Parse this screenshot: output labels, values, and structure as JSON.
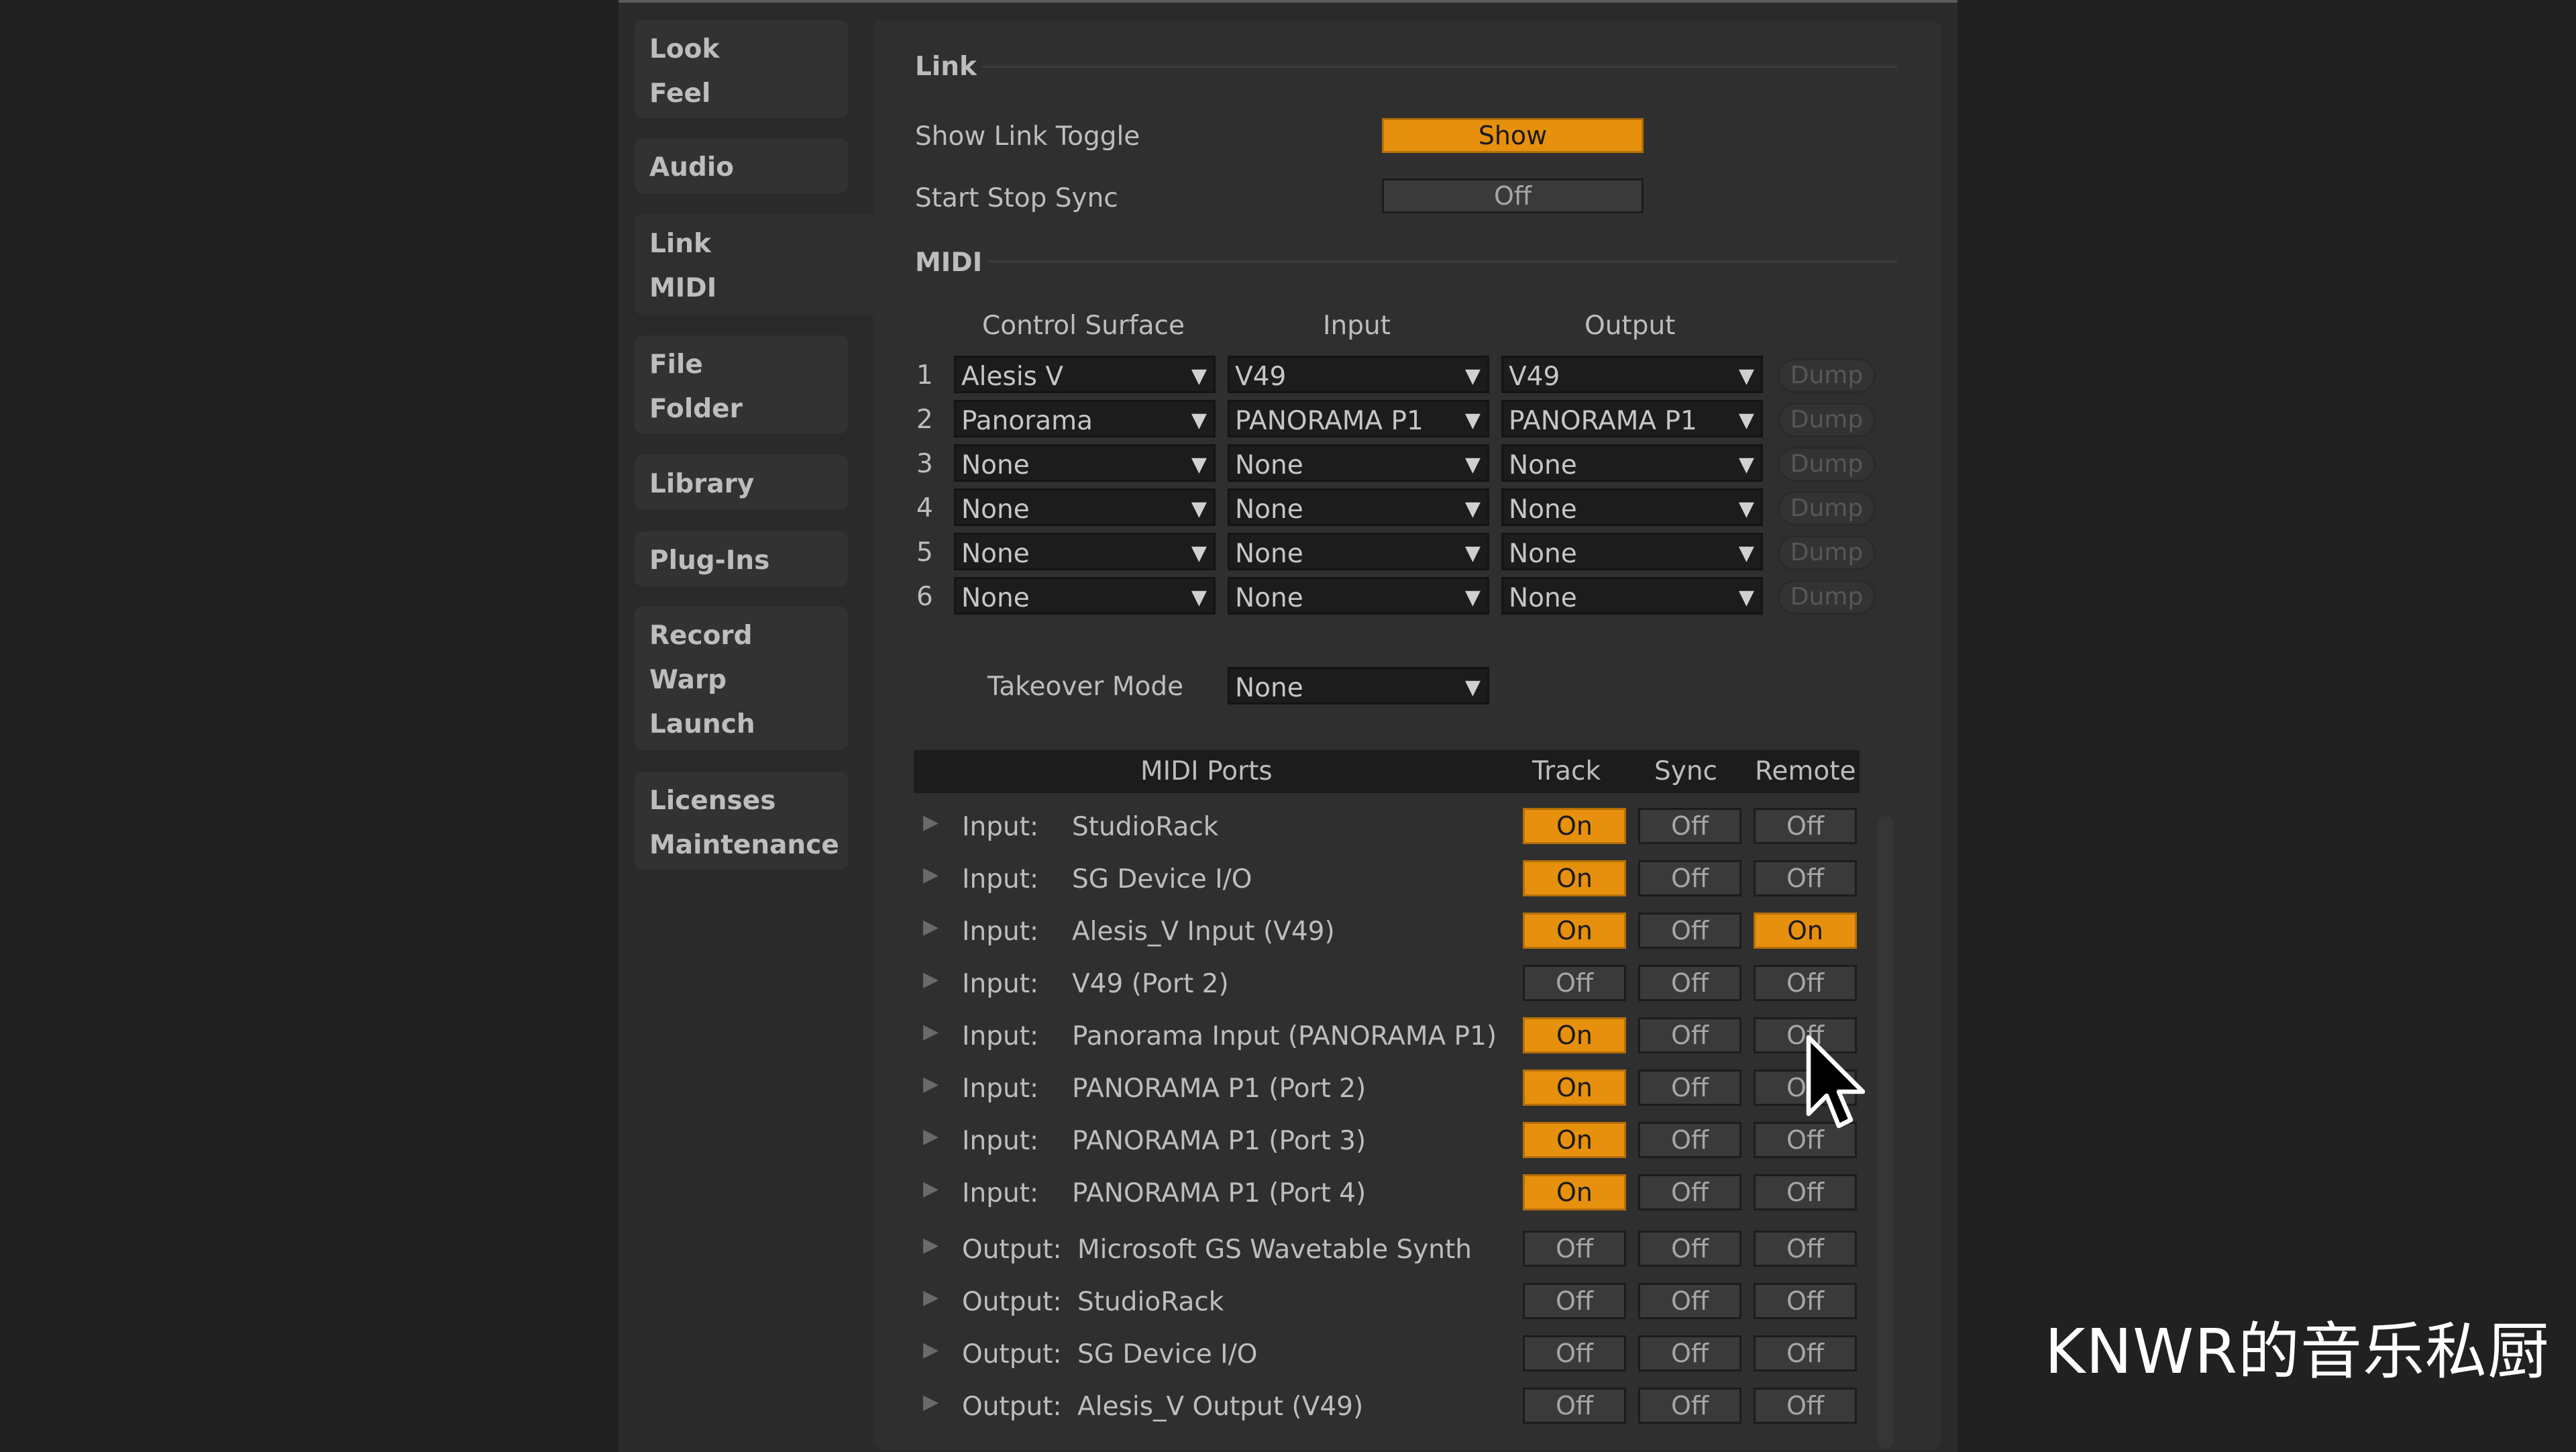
{
  "sidebar": {
    "groups": [
      {
        "items": [
          "Look",
          "Feel"
        ]
      },
      {
        "items": [
          "Audio"
        ]
      },
      {
        "items": [
          "Link",
          "MIDI"
        ]
      },
      {
        "items": [
          "File",
          "Folder"
        ]
      },
      {
        "items": [
          "Library"
        ]
      },
      {
        "items": [
          "Plug-Ins"
        ]
      },
      {
        "items": [
          "Record",
          "Warp",
          "Launch"
        ]
      },
      {
        "items": [
          "Licenses",
          "Maintenance"
        ]
      }
    ]
  },
  "link": {
    "title": "Link",
    "show_link_toggle": {
      "label": "Show Link Toggle",
      "value": "Show"
    },
    "start_stop_sync": {
      "label": "Start Stop Sync",
      "value": "Off"
    }
  },
  "midi": {
    "title": "MIDI",
    "headers": {
      "control_surface": "Control Surface",
      "input": "Input",
      "output": "Output"
    },
    "surfaces": [
      {
        "index": "1",
        "control_surface": "Alesis V",
        "input": "V49",
        "output": "V49",
        "dump": "Dump"
      },
      {
        "index": "2",
        "control_surface": "Panorama",
        "input": "PANORAMA P1",
        "output": "PANORAMA P1",
        "dump": "Dump"
      },
      {
        "index": "3",
        "control_surface": "None",
        "input": "None",
        "output": "None",
        "dump": "Dump"
      },
      {
        "index": "4",
        "control_surface": "None",
        "input": "None",
        "output": "None",
        "dump": "Dump"
      },
      {
        "index": "5",
        "control_surface": "None",
        "input": "None",
        "output": "None",
        "dump": "Dump"
      },
      {
        "index": "6",
        "control_surface": "None",
        "input": "None",
        "output": "None",
        "dump": "Dump"
      }
    ],
    "takeover": {
      "label": "Takeover Mode",
      "value": "None"
    },
    "ports_headers": {
      "ports": "MIDI Ports",
      "track": "Track",
      "sync": "Sync",
      "remote": "Remote"
    },
    "ports": [
      {
        "type": "Input:",
        "name": "StudioRack",
        "track": "On",
        "sync": "Off",
        "remote": "Off"
      },
      {
        "type": "Input:",
        "name": "SG Device I/O",
        "track": "On",
        "sync": "Off",
        "remote": "Off"
      },
      {
        "type": "Input:",
        "name": "Alesis_V Input (V49)",
        "track": "On",
        "sync": "Off",
        "remote": "On"
      },
      {
        "type": "Input:",
        "name": "V49 (Port 2)",
        "track": "Off",
        "sync": "Off",
        "remote": "Off"
      },
      {
        "type": "Input:",
        "name": "Panorama Input (PANORAMA P1)",
        "track": "On",
        "sync": "Off",
        "remote": "Off"
      },
      {
        "type": "Input:",
        "name": "PANORAMA P1 (Port 2)",
        "track": "On",
        "sync": "Off",
        "remote": "Off"
      },
      {
        "type": "Input:",
        "name": "PANORAMA P1 (Port 3)",
        "track": "On",
        "sync": "Off",
        "remote": "Off"
      },
      {
        "type": "Input:",
        "name": "PANORAMA P1 (Port 4)",
        "track": "On",
        "sync": "Off",
        "remote": "Off"
      },
      {
        "type": "Output:",
        "name": "Microsoft GS Wavetable Synth",
        "track": "Off",
        "sync": "Off",
        "remote": "Off"
      },
      {
        "type": "Output:",
        "name": "StudioRack",
        "track": "Off",
        "sync": "Off",
        "remote": "Off"
      },
      {
        "type": "Output:",
        "name": "SG Device I/O",
        "track": "Off",
        "sync": "Off",
        "remote": "Off"
      },
      {
        "type": "Output:",
        "name": "Alesis_V Output (V49)",
        "track": "Off",
        "sync": "Off",
        "remote": "Off"
      }
    ]
  },
  "watermark": "KNWR的音乐私厨",
  "colors": {
    "accent": "#e6900e",
    "background": "#212121",
    "panel": "#2f2f2f"
  },
  "icons": {
    "dropdown": "triangle-down-icon",
    "expand": "triangle-right-icon",
    "cursor": "mouse-pointer-icon"
  }
}
